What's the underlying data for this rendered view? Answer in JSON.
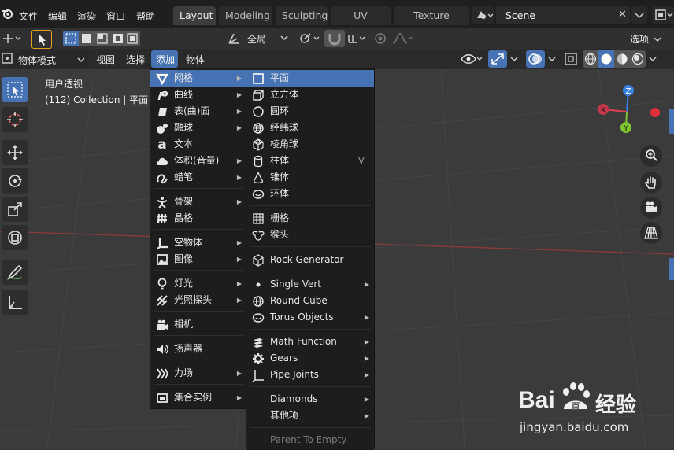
{
  "topbar": {
    "menus": [
      "文件",
      "编辑",
      "渲染",
      "窗口",
      "帮助"
    ],
    "workspaces": [
      "Layout",
      "Modeling",
      "Sculpting",
      "UV Editing",
      "Texture Paint"
    ],
    "active_workspace": "Layout",
    "scene": "Scene"
  },
  "toolheader": {
    "orientation": "全局",
    "options": "选项"
  },
  "viewheader": {
    "mode": "物体模式",
    "menus": [
      "视图",
      "选择",
      "添加",
      "物体"
    ]
  },
  "overlay": {
    "view_name": "用户透视",
    "collection": "(112) Collection | 平面"
  },
  "gizmo": {
    "x": "X",
    "y": "Y",
    "z": "Z",
    "colors": {
      "x": "#e04050",
      "y": "#7fc42f",
      "z": "#3a80e0"
    }
  },
  "add_menu": {
    "items": [
      "网格",
      "曲线",
      "表(曲)面",
      "融球",
      "文本",
      "体积(音量)",
      "蜡笔",
      "骨架",
      "晶格",
      "空物体",
      "图像",
      "灯光",
      "光照探头",
      "相机",
      "扬声器",
      "力场",
      "集合实例"
    ]
  },
  "mesh_menu": {
    "items": [
      "平面",
      "立方体",
      "圆环",
      "经纬球",
      "棱角球",
      "柱体",
      "锥体",
      "环体",
      "栅格",
      "猴头",
      "Rock Generator",
      "Single Vert",
      "Round Cube",
      "Torus Objects",
      "Math Function",
      "Gears",
      "Pipe Joints",
      "Diamonds",
      "其他项",
      "Parent To Empty"
    ],
    "shortcut_cylinder": "V"
  },
  "watermark": {
    "brand": "Bai",
    "brand_tail": "百",
    "cn": "经验",
    "url": "jingyan.baidu.com"
  },
  "accent_color": "#4772b3"
}
